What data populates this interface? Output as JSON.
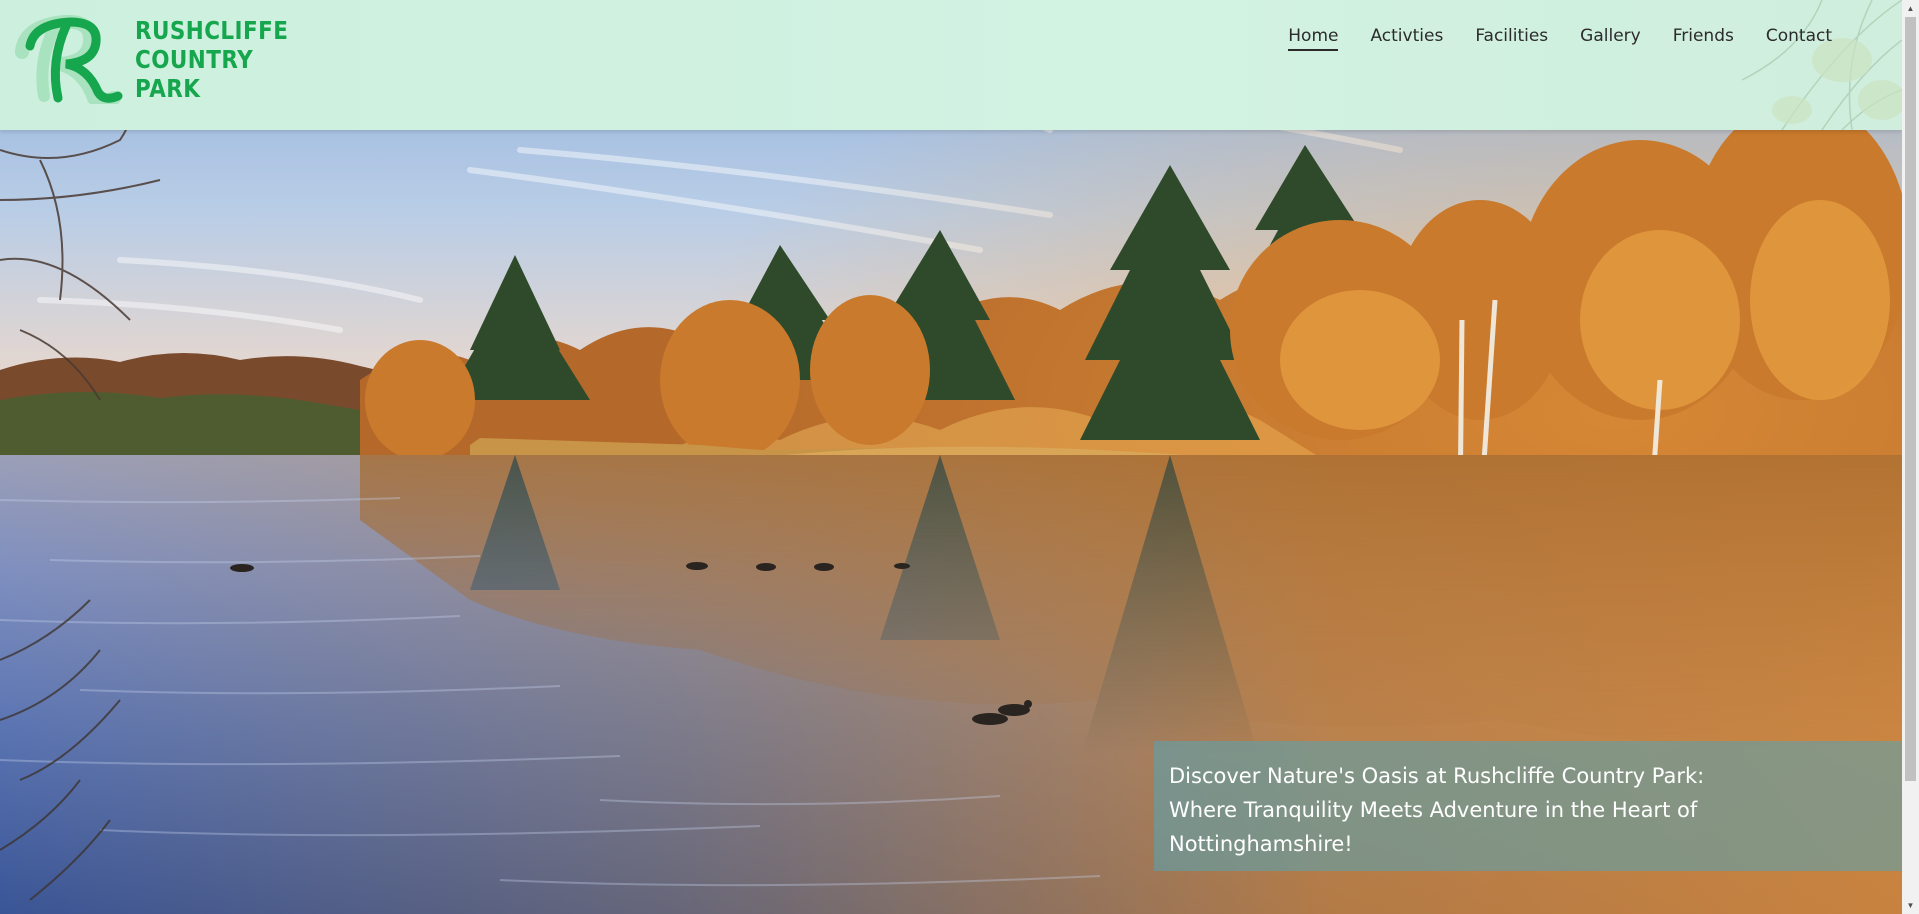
{
  "site": {
    "brand_lines": [
      "RUSHCLIFFE",
      "COUNTRY",
      "PARK"
    ],
    "logo_icon": "rushcliffe-r-logo",
    "brand_color": "#16a64d",
    "header_bg": "#cdf0de"
  },
  "nav": {
    "items": [
      {
        "label": "Home",
        "active": true
      },
      {
        "label": "Activties",
        "active": false
      },
      {
        "label": "Facilities",
        "active": false
      },
      {
        "label": "Gallery",
        "active": false
      },
      {
        "label": "Friends",
        "active": false
      },
      {
        "label": "Contact",
        "active": false
      }
    ]
  },
  "hero": {
    "caption": "Discover Nature's Oasis at Rushcliffe Country Park: Where Tranquility Meets Adventure in the Heart of Nottinghamshire!",
    "caption_lines": [
      "Discover Nature's Oasis at Rushcliffe Country Park:",
      "Where Tranquility Meets Adventure in the Heart of",
      "Nottinghamshire!"
    ],
    "image_subject": "autumn lake with reflected trees and ducks"
  }
}
